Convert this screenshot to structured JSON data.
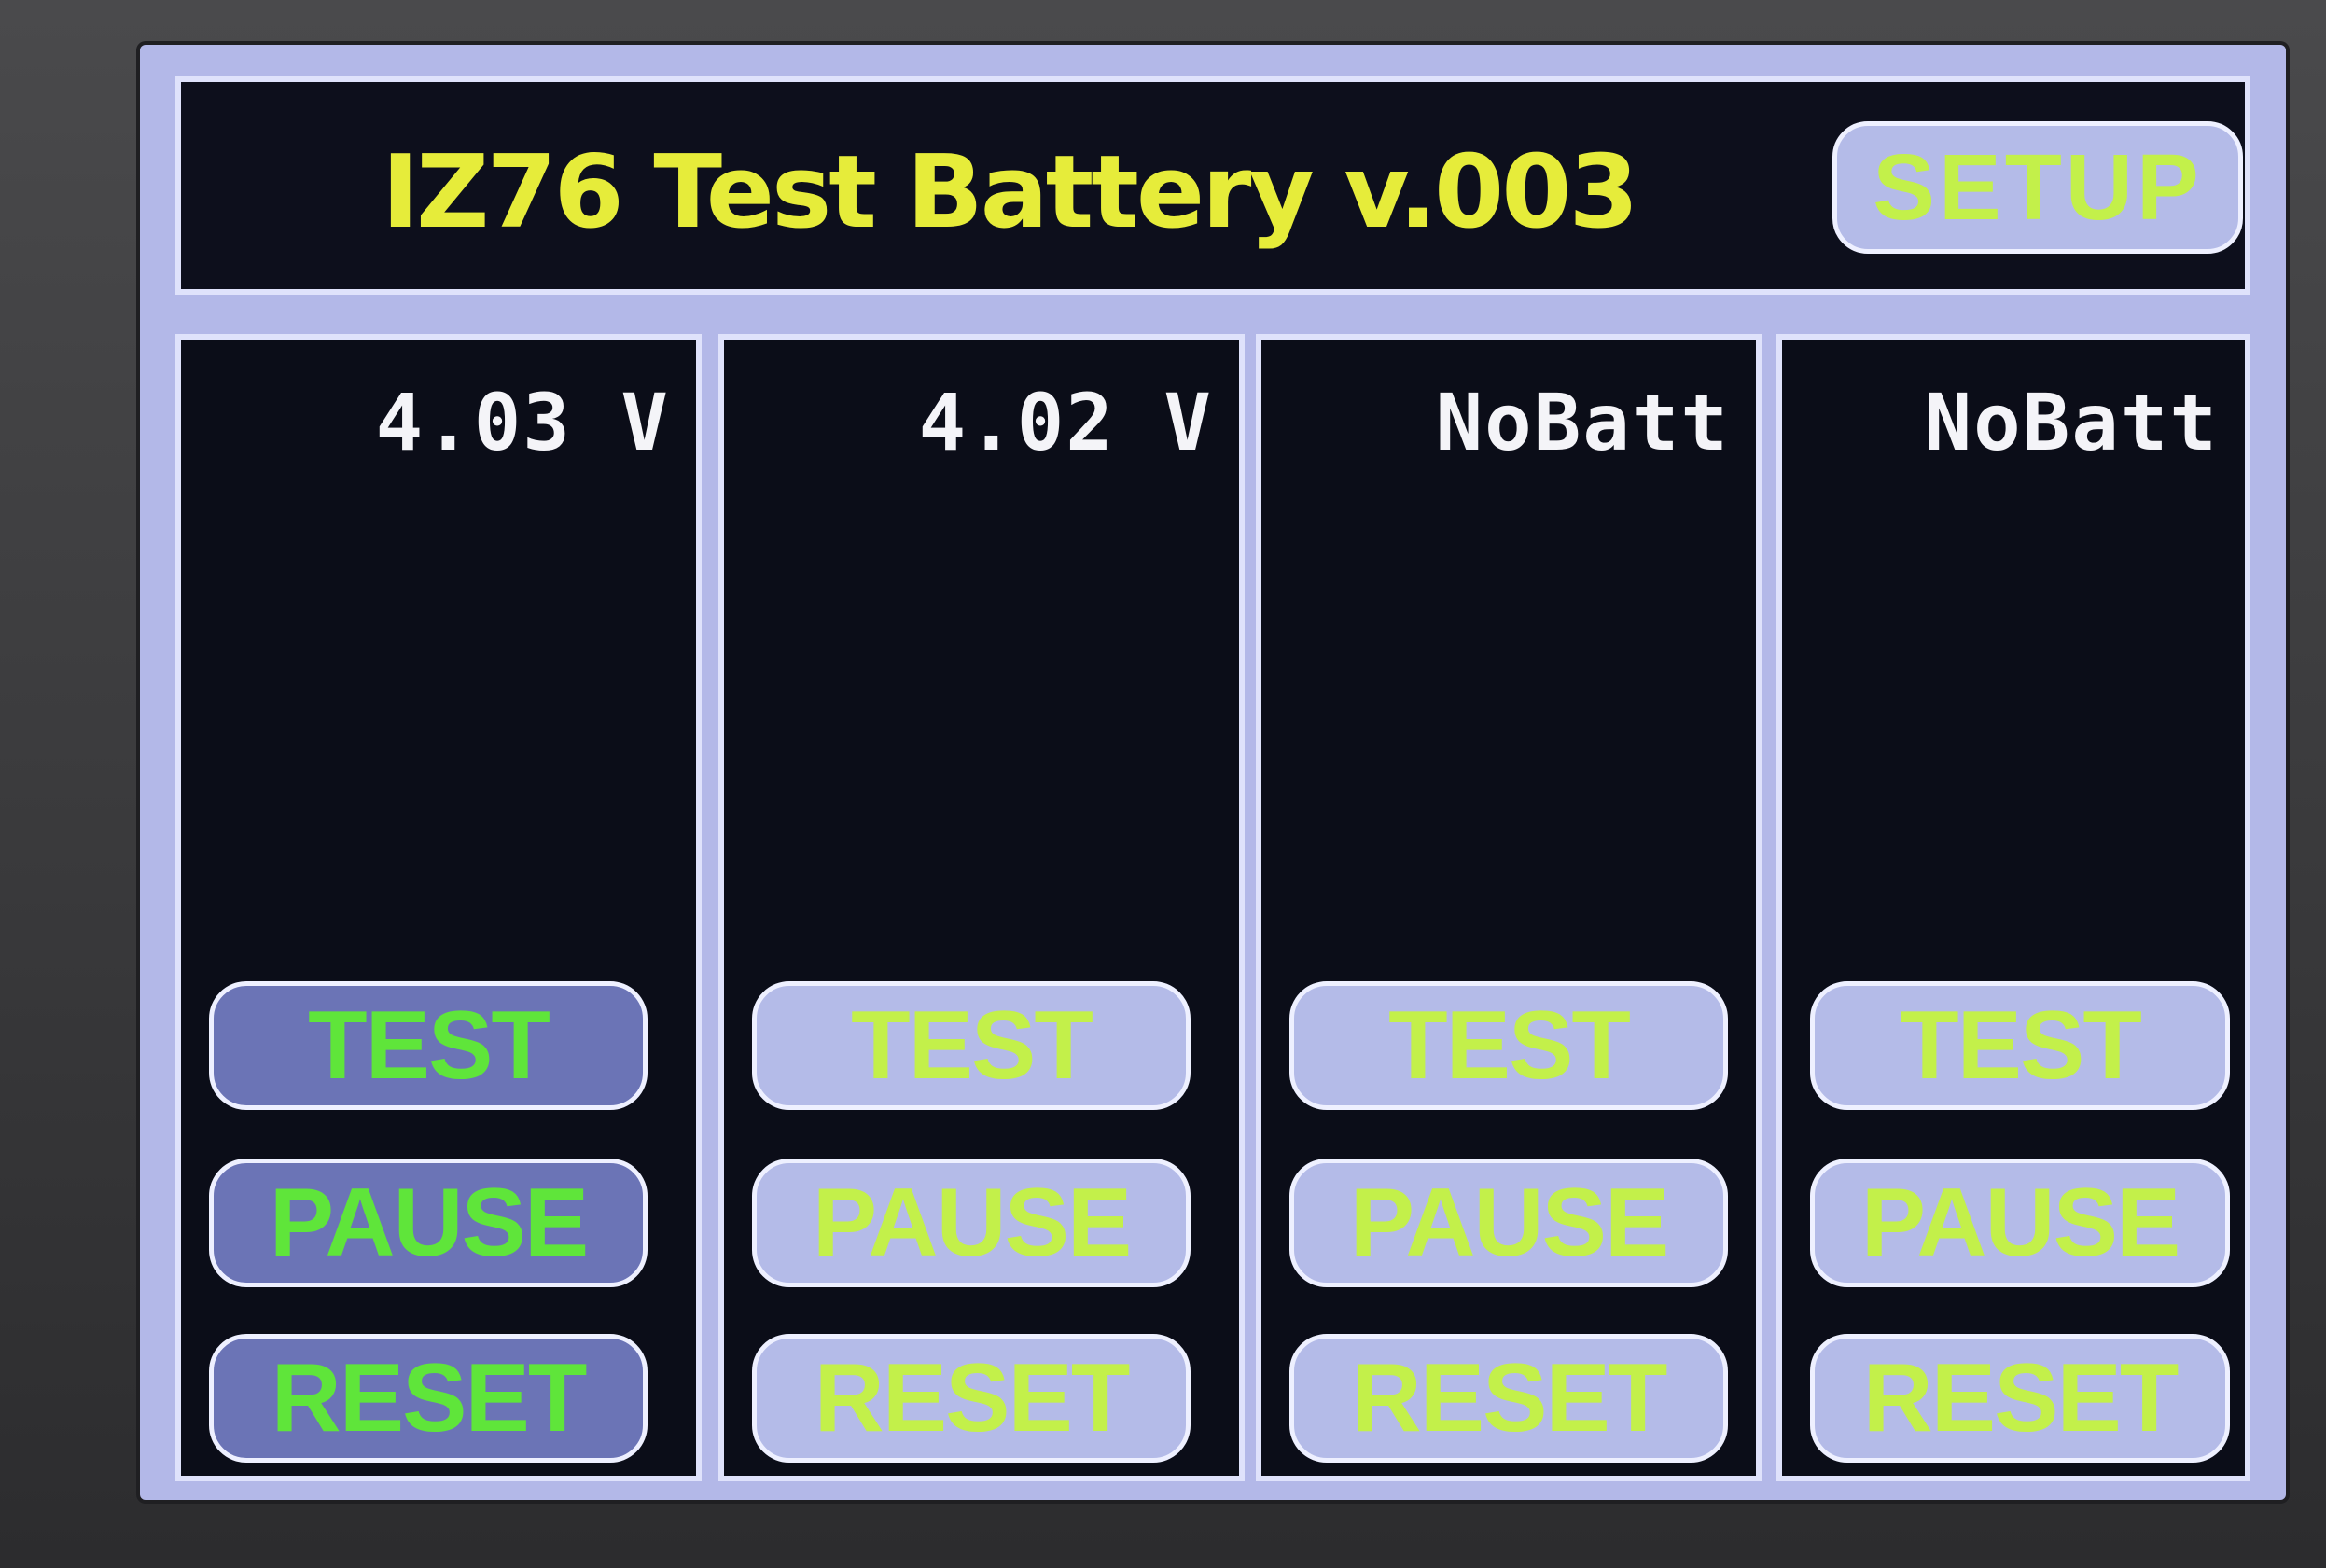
{
  "header": {
    "title": "IZ76 Test Battery v.003",
    "setup_label": "SETUP"
  },
  "channels": [
    {
      "reading": "4.03 V",
      "test_label": "TEST",
      "pause_label": "PAUSE",
      "reset_label": "RESET",
      "state": "active"
    },
    {
      "reading": "4.02 V",
      "test_label": "TEST",
      "pause_label": "PAUSE",
      "reset_label": "RESET",
      "state": "inactive"
    },
    {
      "reading": "NoBatt",
      "test_label": "TEST",
      "pause_label": "PAUSE",
      "reset_label": "RESET",
      "state": "inactive"
    },
    {
      "reading": "NoBatt",
      "test_label": "TEST",
      "pause_label": "PAUSE",
      "reset_label": "RESET",
      "state": "inactive"
    }
  ],
  "colors": {
    "title_yellow": "#e6ec3a",
    "button_text_green": "#5fe53a",
    "button_text_lime": "#c3f04a",
    "panel_background": "#0b0d18",
    "frame_lavender": "#b3b8e8"
  }
}
